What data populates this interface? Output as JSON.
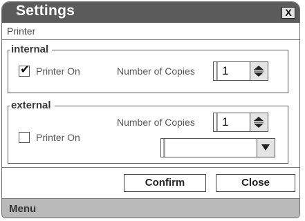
{
  "window": {
    "title": "Settings",
    "close_label": "X",
    "subtitle": "Printer"
  },
  "internal": {
    "legend": "internal",
    "printer_on_label": "Printer On",
    "printer_on_checked": true,
    "copies_label": "Number of Copies",
    "copies_value": "1"
  },
  "external": {
    "legend": "external",
    "printer_on_label": "Printer On",
    "printer_on_checked": false,
    "copies_label": "Number of Copies",
    "copies_value": "1",
    "select_value": ""
  },
  "buttons": {
    "confirm": "Confirm",
    "close": "Close"
  },
  "footer": {
    "menu_label": "Menu"
  }
}
